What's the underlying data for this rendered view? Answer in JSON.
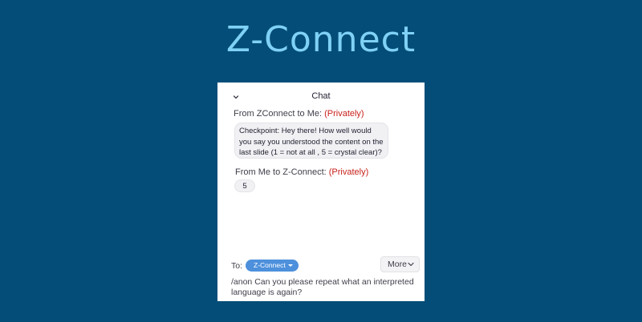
{
  "app": {
    "brand": "Z-Connect"
  },
  "chat": {
    "title": "Chat",
    "messages": [
      {
        "from_label": "From ZConnect to Me: ",
        "privacy": "(Privately)",
        "text": "Checkpoint: Hey there! How well would you say you understood the content on the last slide (1 = not at all , 5 = crystal clear)?"
      },
      {
        "from_label": "From Me to Z-Connect: ",
        "privacy": "(Privately)",
        "text": "5"
      }
    ],
    "composer": {
      "to_label": "To:",
      "recipient": "Z-Connect",
      "more_label": "More",
      "draft": "/anon Can you please repeat what an interpreted language is again?"
    }
  },
  "icons": {
    "collapse": "chevron-down-icon",
    "recipient_dropdown": "caret-down-icon",
    "more_dropdown": "chevron-down-icon"
  },
  "colors": {
    "background": "#044d78",
    "brand_text": "#7fd1f5",
    "privately": "#c8211b",
    "recipient_pill": "#4d90dc"
  }
}
